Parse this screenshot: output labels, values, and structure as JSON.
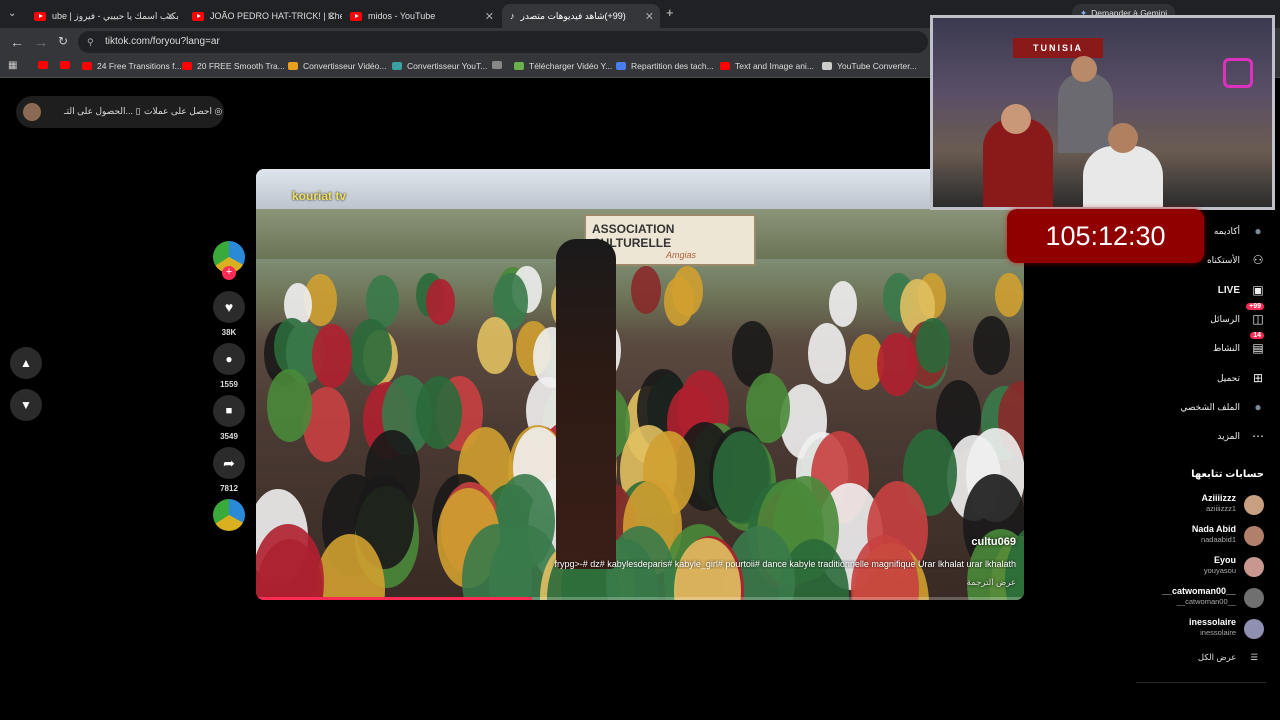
{
  "browser": {
    "tabs": [
      {
        "title": "بكتب اسمك يا حبيبي - فيروز | ube",
        "icon": "youtube-icon"
      },
      {
        "title": "JOÃO PEDRO HAT-TRICK! | Che",
        "icon": "youtube-icon"
      },
      {
        "title": "midos - YouTube",
        "icon": "youtube-icon"
      },
      {
        "title": "(99+)شاهد فيديوهات متصدر",
        "icon": "tiktok-icon"
      }
    ],
    "url": "tiktok.com/foryou?lang=ar",
    "gemini_label": "Demander à Gemini",
    "bookmarks": [
      {
        "label": "",
        "color": "#ff0000"
      },
      {
        "label": "",
        "color": "#ff0000"
      },
      {
        "label": "24 Free Transitions f...",
        "color": "#ff0000"
      },
      {
        "label": "20 FREE Smooth Tra...",
        "color": "#ff0000"
      },
      {
        "label": "Convertisseur Vidéo...",
        "color": "#e8a020"
      },
      {
        "label": "Convertisseur YouT...",
        "color": "#3aa0a0"
      },
      {
        "label": "",
        "color": "#888888"
      },
      {
        "label": "Télécharger Vidéo Y...",
        "color": "#6ab04c"
      },
      {
        "label": "Repartition des tach...",
        "color": "#4a7cf0"
      },
      {
        "label": "Text and Image ani...",
        "color": "#ff0000"
      },
      {
        "label": "YouTube Converter...",
        "color": "#cccccc"
      }
    ]
  },
  "topbar": {
    "get_coins": "احصل على عملات",
    "get_app": "الحصول على التـ..."
  },
  "video": {
    "banner": "ASSOCIATION CULTURELLE",
    "banner_sub": "Amgias",
    "watermark": "kouriat tv",
    "author": "cultu069",
    "caption": "frypg>-# dz# kabylesdeparis# kabyle_girl# pourtoii# dance kabyle traditionnelle magnifique Urar lkhalat urar lkhalath",
    "translate": "عرض الترجمة",
    "progress": 0.36
  },
  "actions": {
    "likes": "38K",
    "comments": "1559",
    "saves": "3549",
    "shares": "7812"
  },
  "nav": [
    {
      "label": "أكاديمه",
      "icon": "avatar-icon"
    },
    {
      "label": "الأستكناه",
      "icon": "friends-icon"
    },
    {
      "label": "LIVE",
      "icon": "live-icon"
    },
    {
      "label": "الرسائل",
      "icon": "messages-icon",
      "badge": "99+"
    },
    {
      "label": "النشاط",
      "icon": "activity-icon",
      "badge": "14"
    },
    {
      "label": "تحميل",
      "icon": "upload-icon"
    },
    {
      "label": "الملف الشخصي",
      "icon": "profile-icon"
    },
    {
      "label": "المزيد",
      "icon": "more-icon"
    }
  ],
  "following": {
    "title": "حسابات تتابعها",
    "accounts": [
      {
        "name": "Aziiiizzz",
        "handle": "aziiiizzz1",
        "color": "#c8a080"
      },
      {
        "name": "Nada Abid",
        "handle": "nadaabid1",
        "color": "#b0806a"
      },
      {
        "name": "Eyou",
        "handle": "youyasou",
        "color": "#c89890"
      },
      {
        "name": "__catwoman00__",
        "handle": "__catwoman00__",
        "color": "#707070"
      },
      {
        "name": "inessolaire",
        "handle": "inessolaire",
        "color": "#9090b0"
      }
    ],
    "see_all": "عرض الكل"
  },
  "overlay": {
    "timer": "105:12:30",
    "sign": "TUNISIA"
  }
}
